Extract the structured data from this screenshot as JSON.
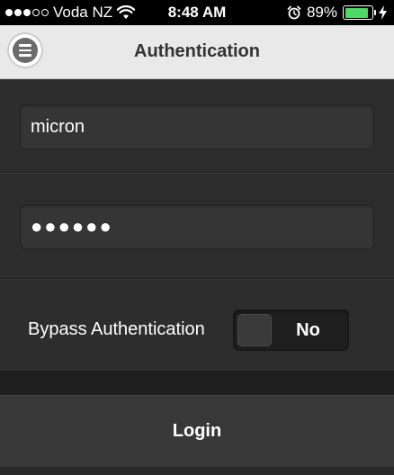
{
  "status_bar": {
    "carrier": "Voda NZ",
    "time": "8:48 AM",
    "battery_percent": "89%",
    "battery_level": 0.89,
    "signal_bars_filled": 3,
    "signal_bars_total": 5,
    "colors": {
      "battery": "#4cd964"
    }
  },
  "nav": {
    "title": "Authentication"
  },
  "form": {
    "username_value": "micron",
    "password_value": "●●●●●●",
    "bypass_label": "Bypass Authentication",
    "bypass_value": "No"
  },
  "login_button": {
    "label": "Login"
  }
}
